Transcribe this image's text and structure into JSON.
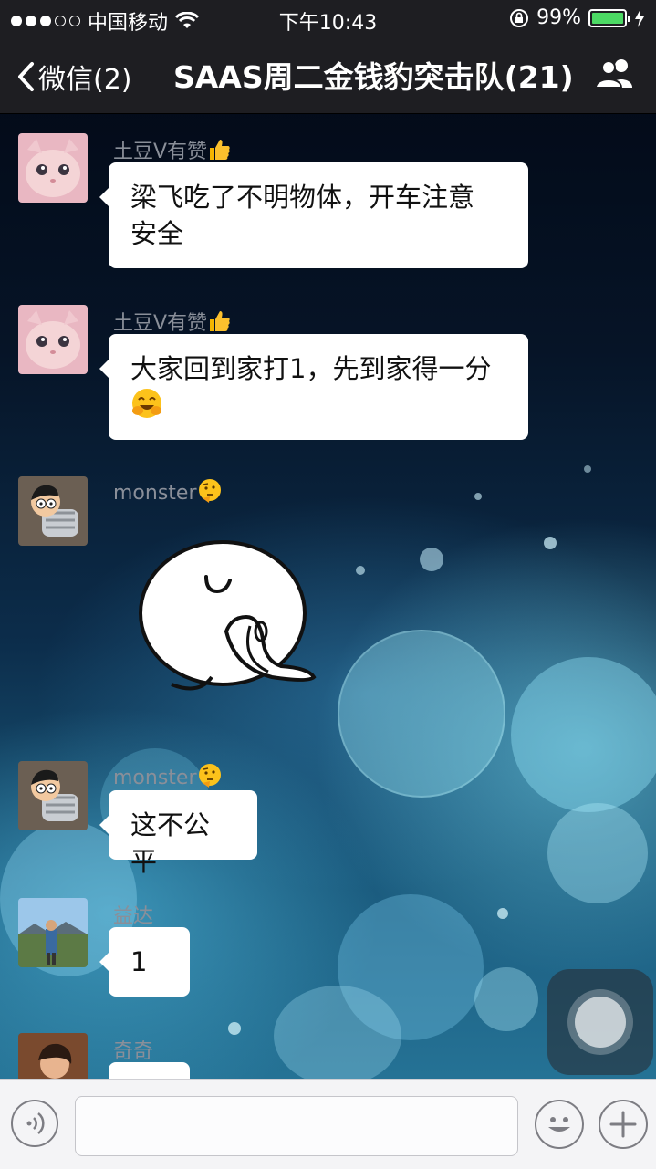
{
  "status_bar": {
    "carrier": "中国移动",
    "time": "下午10:43",
    "battery_percent": "99%",
    "battery_level": 0.99,
    "signal_bars": 3
  },
  "nav": {
    "back_label": "微信(2)",
    "title": "SAAS周二金钱豹突击队(21)",
    "people_icon": "group-info-icon"
  },
  "messages": [
    {
      "sender": "土豆V有赞",
      "sender_emoji": "thumbs-up",
      "text": [
        "梁飞吃了不明物体，开车注意",
        "安全"
      ],
      "avatar": "kitten-avatar"
    },
    {
      "sender": "土豆V有赞",
      "sender_emoji": "thumbs-up",
      "text": [
        "大家回到家打1，先到家得一分"
      ],
      "trailing_emoji": "laughing-face",
      "avatar": "kitten-avatar"
    },
    {
      "sender": "monster",
      "sender_emoji": "thinking-face",
      "sticker": "white-blob-sticker",
      "avatar": "cartoon-boy-avatar"
    },
    {
      "sender": "monster",
      "sender_emoji": "thinking-face",
      "text": [
        "这不公平"
      ],
      "avatar": "cartoon-boy-avatar"
    },
    {
      "sender": "益达",
      "text": [
        "1"
      ],
      "avatar": "landscape-person-avatar"
    },
    {
      "sender": "奇奇",
      "text": [
        ""
      ],
      "avatar": "portrait-avatar"
    }
  ],
  "input_bar": {
    "voice_icon": "voice-icon",
    "emoji_icon": "emoji-icon",
    "plus_icon": "plus-icon",
    "value": ""
  },
  "colors": {
    "bar_bg": "#1e1e22",
    "bubble": "#ffffff",
    "battery": "#4cd964",
    "sender_text": "#8a8f99"
  }
}
